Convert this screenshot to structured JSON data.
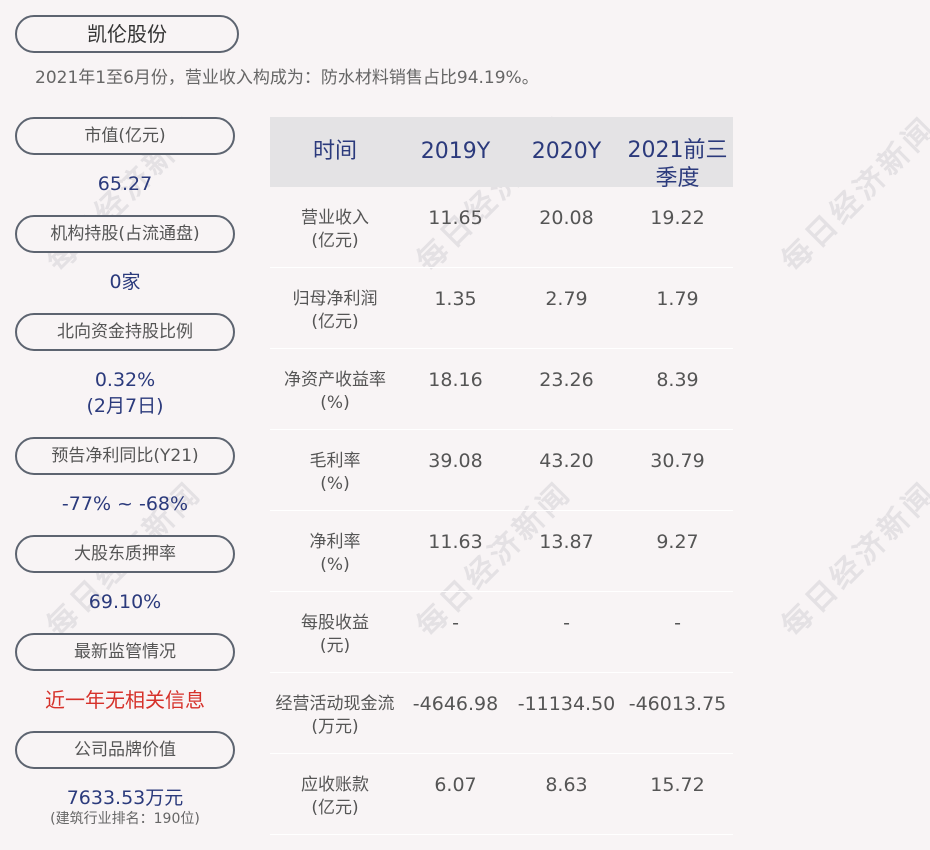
{
  "title": "凯伦股份",
  "subtitle": "2021年1至6月份，营业收入构成为：防水材料销售占比94.19%。",
  "watermark": "每日经济新闻",
  "sidebar": [
    {
      "label": "市值(亿元)",
      "value": "65.27"
    },
    {
      "label": "机构持股(占流通盘)",
      "value": "0家"
    },
    {
      "label": "北向资金持股比例",
      "value": "0.32%",
      "value2": "(2月7日)"
    },
    {
      "label": "预告净利同比(Y21)",
      "value": "-77% ~ -68%"
    },
    {
      "label": "大股东质押率",
      "value": "69.10%"
    },
    {
      "label": "最新监管情况",
      "value": "近一年无相关信息"
    },
    {
      "label": "公司品牌价值",
      "value": "7633.53万元",
      "note": "(建筑行业排名：190位)"
    }
  ],
  "table": {
    "headers": [
      "时间",
      "2019Y",
      "2020Y",
      "2021前三",
      "季度"
    ],
    "rows": [
      {
        "l1": "营业收入",
        "l2": "(亿元)",
        "v": [
          "11.65",
          "20.08",
          "19.22"
        ]
      },
      {
        "l1": "归母净利润",
        "l2": "(亿元)",
        "v": [
          "1.35",
          "2.79",
          "1.79"
        ]
      },
      {
        "l1": "净资产收益率",
        "l2": "(%)",
        "v": [
          "18.16",
          "23.26",
          "8.39"
        ]
      },
      {
        "l1": "毛利率",
        "l2": "(%)",
        "v": [
          "39.08",
          "43.20",
          "30.79"
        ]
      },
      {
        "l1": "净利率",
        "l2": "(%)",
        "v": [
          "11.63",
          "13.87",
          "9.27"
        ]
      },
      {
        "l1": "每股收益",
        "l2": "(元)",
        "v": [
          "-",
          "-",
          "-"
        ]
      },
      {
        "l1": "经营活动现金流",
        "l2": "(万元)",
        "v": [
          "-4646.98",
          "-11134.50",
          "-46013.75"
        ]
      },
      {
        "l1": "应收账款",
        "l2": "(亿元)",
        "v": [
          "6.07",
          "8.63",
          "15.72"
        ]
      }
    ]
  }
}
